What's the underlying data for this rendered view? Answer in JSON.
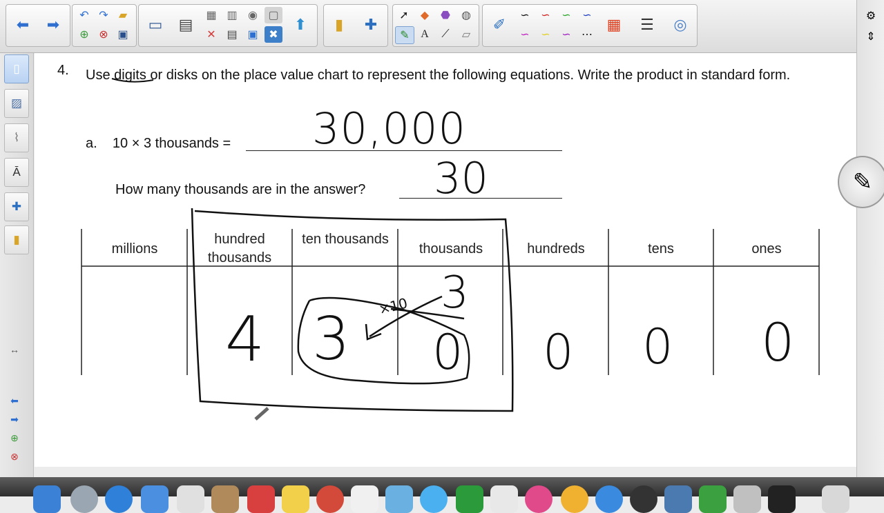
{
  "toolbar": {
    "groups": [
      {
        "name": "navigation",
        "buttons": [
          "back-icon",
          "forward-icon"
        ]
      },
      {
        "name": "page-actions",
        "buttons": [
          "undo-icon",
          "redo-icon",
          "open-icon",
          "add-page-icon",
          "delete-page-icon",
          "save-icon"
        ]
      },
      {
        "name": "display",
        "buttons": [
          "screen-shade-icon",
          "capture-icon",
          "paste-icon",
          "table-icon",
          "show-hide-icon",
          "full-screen-icon",
          "document-camera-icon",
          "delete-icon"
        ]
      },
      {
        "name": "response",
        "buttons": [
          "response-icon"
        ]
      },
      {
        "name": "addons",
        "buttons": [
          "notebook-icon",
          "addon-icon"
        ]
      },
      {
        "name": "tools",
        "buttons": [
          "select-icon",
          "shapes-icon",
          "eraser-icon",
          "fill-icon",
          "pens-icon",
          "text-icon",
          "line-icon",
          "magic-pen-icon"
        ]
      },
      {
        "name": "pen-styles",
        "buttons": [
          "pen-icon",
          "pen-black-icon",
          "pen-red-icon",
          "pen-green-icon",
          "pen-blue-icon",
          "pen-magenta-icon",
          "pen-yellow-icon",
          "pen-purple-icon",
          "pen-dashed-icon",
          "color-palette-icon",
          "line-style-icon",
          "properties-icon"
        ]
      }
    ]
  },
  "question": {
    "number": "4.",
    "text_before": "Use ",
    "underlined": "digits",
    "text_after": " or disks  on the place value chart to represent the following equations.  Write the product in standard form.",
    "part_a_label": "a.",
    "part_a_expr": "10 × 3 thousands =",
    "how_many": "How many thousands are in the answer?",
    "handwritten_answer": "30,000",
    "handwritten_count": "30"
  },
  "place_value_chart": {
    "columns": [
      "millions",
      "hundred thousands",
      "ten thousands",
      "thousands",
      "hundreds",
      "tens",
      "ones"
    ],
    "handwritten_digits": [
      "",
      "4",
      "3",
      "0",
      "0",
      "0",
      "0"
    ],
    "annotation_times_ten": "×10",
    "annotation_carried": "3"
  },
  "sidebar": {
    "tabs": [
      "page-sorter-icon",
      "gallery-icon",
      "attachments-icon",
      "properties-icon",
      "addons-icon",
      "lesson-activity-icon"
    ],
    "bottom": [
      "resize-icon",
      "previous-page-icon",
      "next-page-icon",
      "add-page-small-icon",
      "delete-page-small-icon"
    ]
  },
  "rightbar": {
    "buttons": [
      "settings-icon",
      "move-toolbar-icon"
    ]
  },
  "colors": {
    "selected_blue": "#c9dcf2",
    "ink": "#111111",
    "canvas": "#ffffff"
  }
}
